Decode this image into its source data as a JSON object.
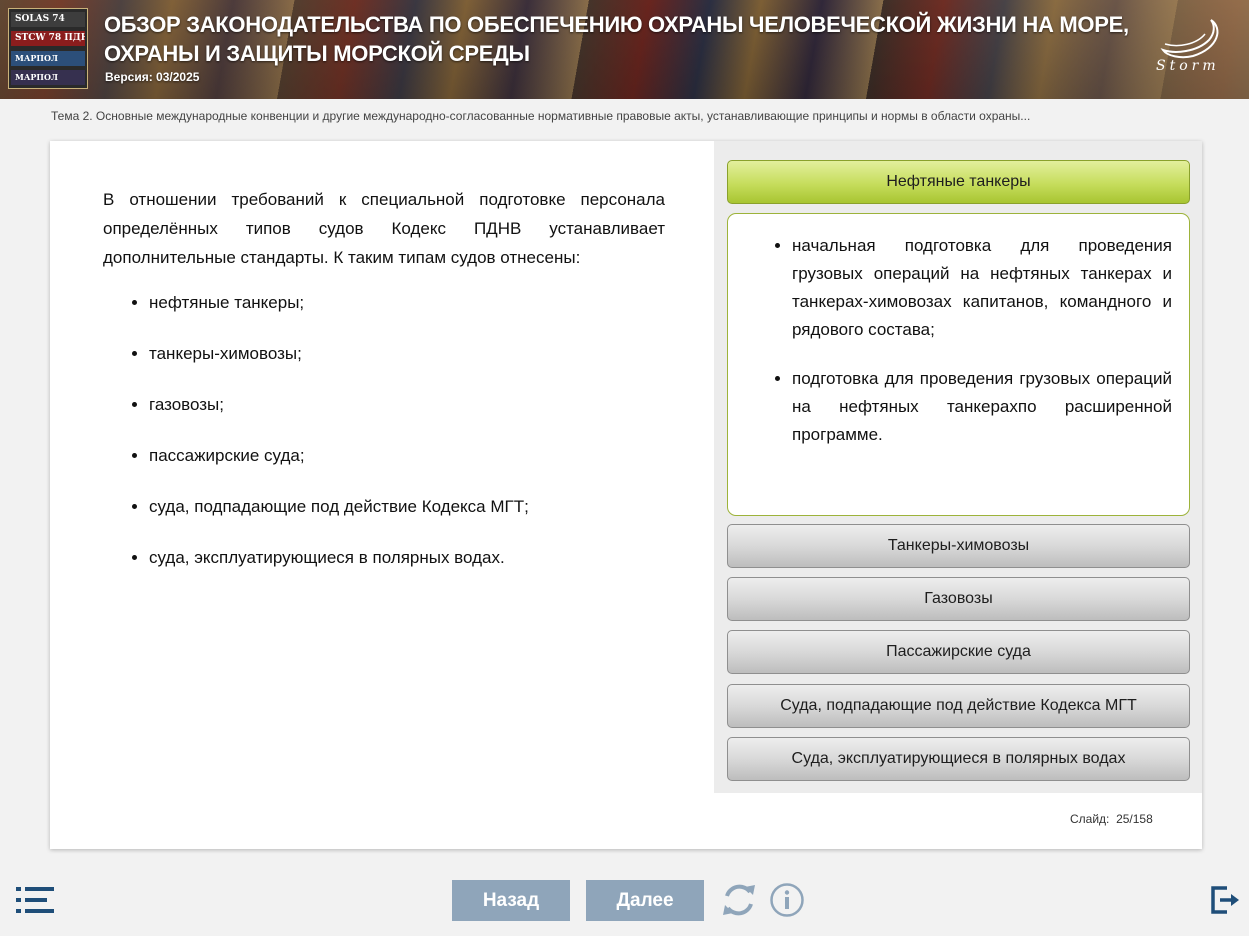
{
  "header": {
    "logo_books": [
      "SOLAS 74",
      "STCW 78 ПДНВ",
      "МАРПОЛ",
      "МАРПОЛ"
    ],
    "title": "ОБЗОР ЗАКОНОДАТЕЛЬСТВА ПО ОБЕСПЕЧЕНИЮ ОХРАНЫ ЧЕЛОВЕЧЕСКОЙ ЖИЗНИ НА МОРЕ, ОХРАНЫ И ЗАЩИТЫ МОРСКОЙ СРЕДЫ",
    "version": "Версия: 03/2025",
    "brand": "Storm"
  },
  "breadcrumb": "Тема 2. Основные международные конвенции и другие международно-согласованные нормативные правовые акты, устанавливающие принципы и нормы в области охраны...",
  "content": {
    "intro": "В отношении требований к специальной подготовке персонала определённых типов судов Кодекс ПДНВ устанавливает дополнительные стандарты. К таким типам судов отнесены:",
    "list": [
      "нефтяные танкеры;",
      "танкеры-химовозы;",
      "газовозы;",
      "пассажирские суда;",
      "суда, подпадающие под действие Кодекса МГТ;",
      "суда, эксплуатирующиеся в полярных водах."
    ]
  },
  "accordion": {
    "items": [
      "Нефтяные танкеры",
      "Танкеры-химовозы",
      "Газовозы",
      "Пассажирские суда",
      "Суда, подпадающие под действие Кодекса МГТ",
      "Суда, эксплуатирующиеся в полярных водах"
    ],
    "active_content": [
      "начальная подготовка для проведения грузовых операций на нефтяных танкерах и танкерах-химовозах капитанов, командного и рядового состава;",
      "подготовка для проведения грузовых операций на нефтяных танкерахпо расширенной программе."
    ]
  },
  "slide": {
    "label": "Слайд:",
    "value": "25/158"
  },
  "nav": {
    "back": "Назад",
    "next": "Далее"
  },
  "colors": {
    "active_tab": "#c6dd5c",
    "nav_button": "#8fa5ba",
    "icon": "#1f4e79"
  }
}
